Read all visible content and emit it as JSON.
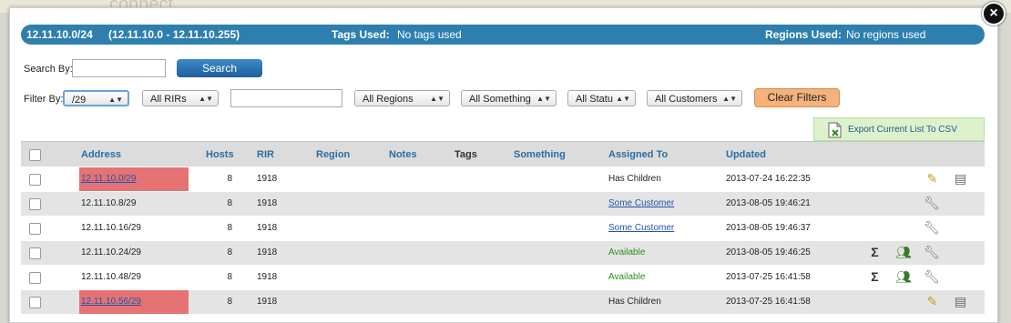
{
  "background": {
    "logo_text": "connect"
  },
  "header": {
    "subnet": "12.11.10.0/24",
    "range": "(12.11.10.0 - 12.11.10.255)",
    "tags_label": "Tags Used:",
    "tags_value": "No tags used",
    "regions_label": "Regions Used:",
    "regions_value": "No regions used"
  },
  "search": {
    "label": "Search By:",
    "value": "",
    "button": "Search"
  },
  "filters": {
    "label": "Filter By:",
    "mask": "/29",
    "rir": "All RIRs",
    "text_value": "",
    "regions": "All Regions",
    "something": "All Something",
    "status": "All Statu",
    "customers": "All Customers",
    "clear_button": "Clear Filters"
  },
  "export": {
    "label": "Export Current List To CSV"
  },
  "table": {
    "headers": [
      "Address",
      "Hosts",
      "RIR",
      "Region",
      "Notes",
      "Tags",
      "Something",
      "Assigned To",
      "Updated"
    ],
    "rows": [
      {
        "address": "12.11.10.0/29",
        "hosts": "8",
        "rir": "1918",
        "assigned": "Has Children",
        "updated": "2013-07-24 16:22:35"
      },
      {
        "address": "12.11.10.8/29",
        "hosts": "8",
        "rir": "1918",
        "assigned": "Some Customer",
        "updated": "2013-08-05 19:46:21"
      },
      {
        "address": "12.11.10.16/29",
        "hosts": "8",
        "rir": "1918",
        "assigned": "Some Customer",
        "updated": "2013-08-05 19:46:37"
      },
      {
        "address": "12.11.10.24/29",
        "hosts": "8",
        "rir": "1918",
        "assigned": "Available",
        "updated": "2013-08-05 19:46:25"
      },
      {
        "address": "12.11.10.48/29",
        "hosts": "8",
        "rir": "1918",
        "assigned": "Available",
        "updated": "2013-07-25 16:41:58"
      },
      {
        "address": "12.11.10.56/29",
        "hosts": "8",
        "rir": "1918",
        "assigned": "Has Children",
        "updated": "2013-07-25 16:41:58"
      }
    ]
  },
  "colors": {
    "header_bar": "#2e7fb0",
    "highlight": "#e57373",
    "available": "#2e8b20",
    "clear_button": "#f6b27c"
  }
}
